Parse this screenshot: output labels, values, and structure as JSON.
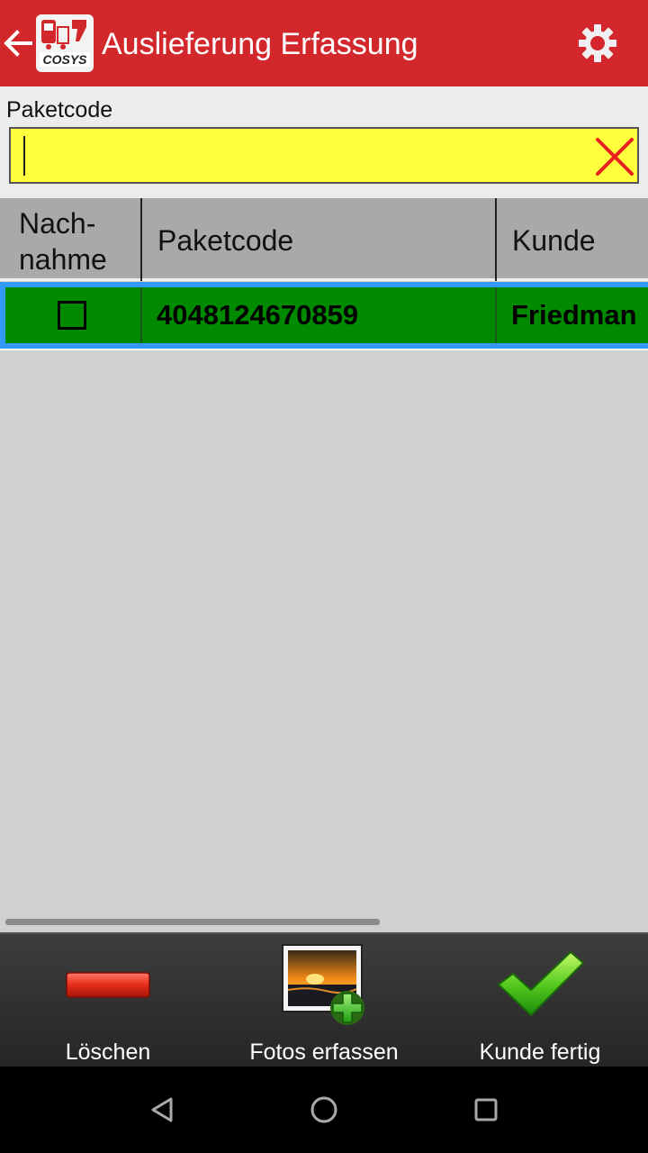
{
  "app_bar": {
    "title": "Auslieferung Erfassung",
    "back_icon": "arrow-left-icon",
    "settings_icon": "gear-icon",
    "color": "#d2282c"
  },
  "form": {
    "label": "Paketcode",
    "value": "",
    "placeholder": "",
    "clear_icon": "red-x-icon",
    "input_background": "#ffff3d"
  },
  "table": {
    "columns": [
      "Nach-\nnahme",
      "Paketcode",
      "Kunde"
    ],
    "rows": [
      {
        "nachnahme": false,
        "paketcode": "4048124670859",
        "kunde": "Friedman"
      }
    ],
    "selected_row_color": "#008a00",
    "selection_border_color": "#3399ff"
  },
  "toolbar": {
    "delete_label": "Löschen",
    "photos_label": "Fotos erfassen",
    "done_label": "Kunde fertig"
  },
  "navigation": {
    "back": "nav-back-icon",
    "home": "nav-home-icon",
    "recents": "nav-recents-icon"
  }
}
